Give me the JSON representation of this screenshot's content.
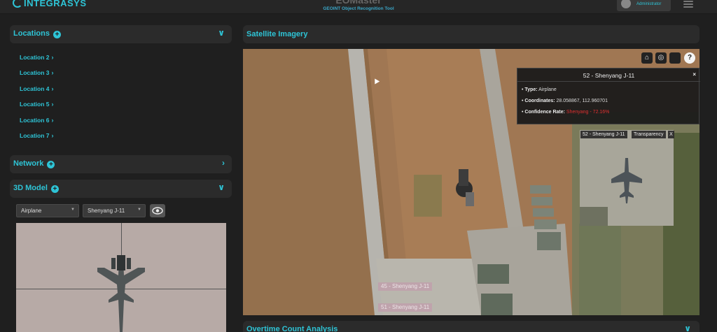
{
  "header": {
    "logo_text": "INTEGRASYS",
    "app_title": "EOMaster",
    "app_subtitle": "GEOINT Object Recognition Tool",
    "user_name": "admin",
    "user_role": "Administrator"
  },
  "locations": {
    "title": "Locations",
    "items": [
      "Location 2",
      "Location 3",
      "Location 4",
      "Location 5",
      "Location 6",
      "Location 7"
    ]
  },
  "network": {
    "title": "Network"
  },
  "model3d": {
    "title": "3D Model",
    "type_select": "Airplane",
    "model_select": "Shenyang J-11"
  },
  "satellite": {
    "title": "Satellite Imagery"
  },
  "info_popup": {
    "title": "52 - Shenyang J-11",
    "close": "×",
    "type_label": "Type:",
    "type_value": "Airplane",
    "coords_label": "Coordinates:",
    "coords_value": "28.058867, 112.960701",
    "confidence_label": "Confidence Rate:",
    "confidence_value": "Shenyang - 72.16%"
  },
  "thumbnail": {
    "label": "52 - Shenyang J-11",
    "transparency": "Transparency",
    "close": "X"
  },
  "detections": [
    "45 - Shenyang J-11",
    "51 - Shenyang J-11"
  ],
  "overtime": {
    "title": "Overtime Count Analysis"
  },
  "colors": {
    "accent": "#2ec4d6",
    "panel": "#2b2b2b",
    "background": "#1f1f1f",
    "alert": "#e03030"
  }
}
